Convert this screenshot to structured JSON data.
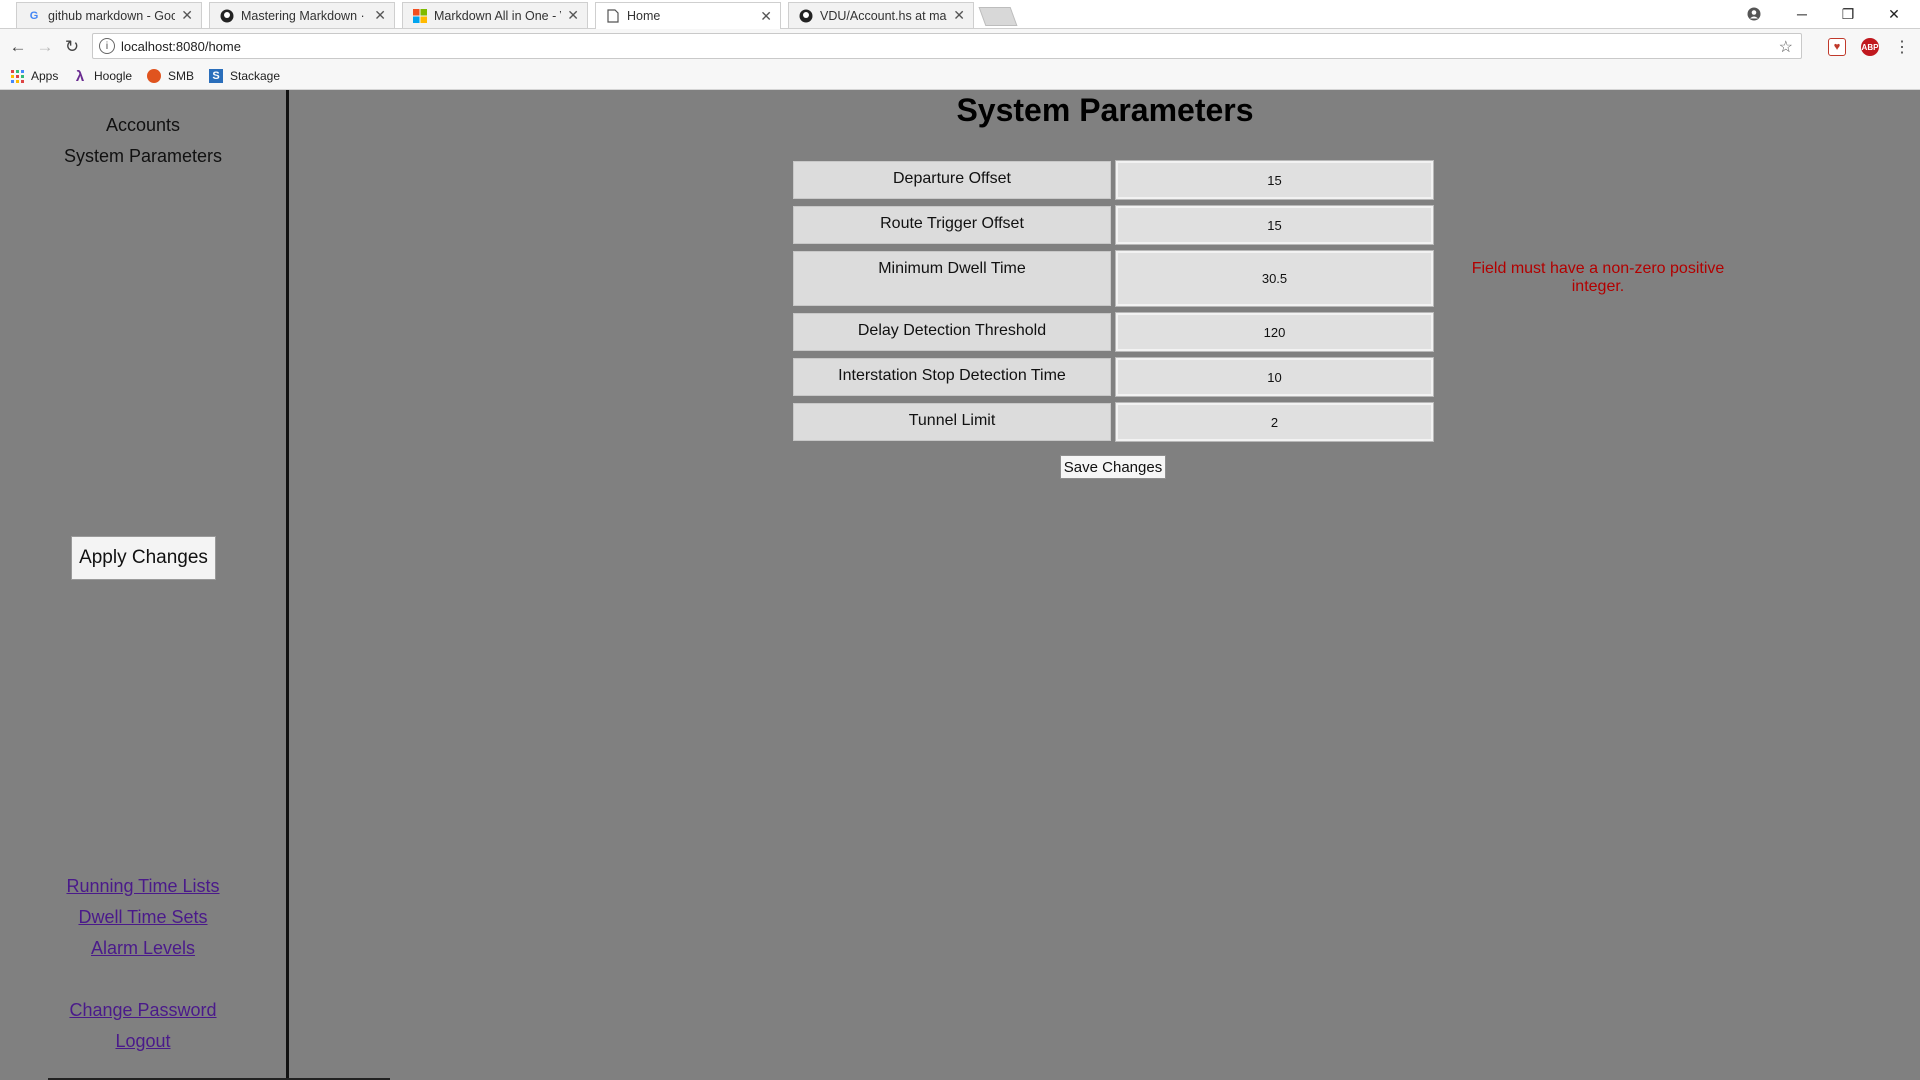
{
  "browser": {
    "tabs": [
      {
        "title": "github markdown - Goo",
        "favicon": "google-g-icon"
      },
      {
        "title": "Mastering Markdown · G",
        "favicon": "github-icon"
      },
      {
        "title": "Markdown All in One - V",
        "favicon": "windows-icon"
      },
      {
        "title": "Home",
        "favicon": "page-icon",
        "active": true
      },
      {
        "title": "VDU/Account.hs at mast",
        "favicon": "github-icon"
      }
    ],
    "url": "localhost:8080/home",
    "bookmarks": [
      {
        "label": "Apps",
        "icon": "apps-grid-icon"
      },
      {
        "label": "Hoogle",
        "icon": "lambda-icon"
      },
      {
        "label": "SMB",
        "icon": "smb-icon"
      },
      {
        "label": "Stackage",
        "icon": "stackage-icon"
      }
    ],
    "extensions": {
      "abp": "ABP"
    }
  },
  "sidebar": {
    "nav": [
      "Accounts",
      "System Parameters"
    ],
    "apply_label": "Apply Changes",
    "footer_links": [
      "Running Time Lists",
      "Dwell Time Sets",
      "Alarm Levels",
      "Change Password",
      "Logout"
    ]
  },
  "main": {
    "title": "System Parameters",
    "params": [
      {
        "label": "Departure Offset",
        "value": "15"
      },
      {
        "label": "Route Trigger Offset",
        "value": "15"
      },
      {
        "label": "Minimum Dwell Time",
        "value": "30.5"
      },
      {
        "label": "Delay Detection Threshold",
        "value": "120"
      },
      {
        "label": "Interstation Stop Detection Time",
        "value": "10"
      },
      {
        "label": "Tunnel Limit",
        "value": "2"
      }
    ],
    "error_message": "Field must have a non-zero positive integer.",
    "save_label": "Save Changes"
  },
  "colors": {
    "page_bg": "#808080",
    "error": "#b20000",
    "link": "#4a1a8a"
  }
}
